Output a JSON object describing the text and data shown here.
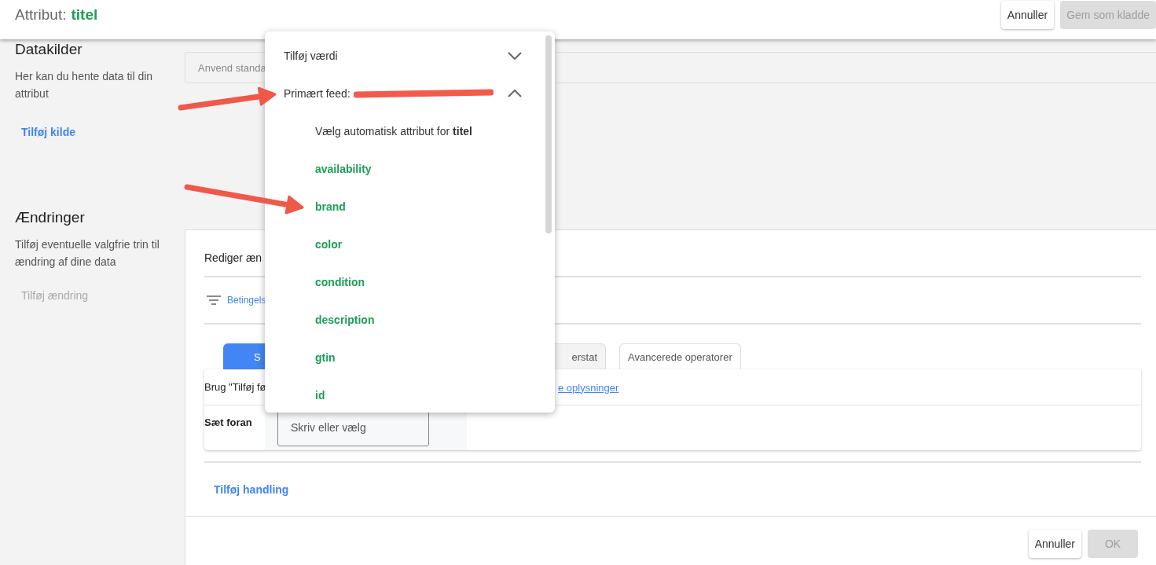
{
  "header": {
    "title_label": "Attribut:",
    "title_value": "titel",
    "buttons": [
      {
        "label": "Annuller",
        "disabled": false
      },
      {
        "label": "Gem som kladde",
        "disabled": true
      }
    ]
  },
  "data_sources": {
    "heading": "Datakilder",
    "description": "Her kan du hente data til din attribut",
    "add_link": "Tilføj kilde",
    "source_field": {
      "placeholder": "Anvend standa"
    }
  },
  "changes": {
    "heading": "Ændringer",
    "description": "Tilføj eventuelle valgfrie trin til ændring af dine data",
    "add_link": {
      "label": "Tilføj ændring",
      "disabled": true
    }
  },
  "editor": {
    "title": "Rediger æn",
    "condition_link": "Betingels",
    "tabs": [
      {
        "label": "S",
        "selected": true
      },
      {
        "label": "erstat",
        "selected": false
      },
      {
        "label": "Avancerede operatorer",
        "selected": false
      }
    ],
    "info_text": "Brug \"Tilføj fø",
    "info_link": "e oplysninger",
    "prefix_label": "Sæt foran",
    "prefix_field": {
      "placeholder": "Skriv eller vælg"
    },
    "add_action": "Tilføj handling",
    "buttons": [
      {
        "label": "Annuller",
        "disabled": false
      },
      {
        "label": "OK",
        "disabled": true
      }
    ]
  },
  "dropdown": {
    "sections": [
      {
        "label": "Tilføj værdi",
        "expanded": false,
        "redacted": false
      },
      {
        "label": "Primært feed:",
        "expanded": true,
        "redacted": true,
        "items": [
          {
            "kind": "option",
            "text": "Vælg automatisk attribut for **titel**"
          },
          {
            "kind": "attribute",
            "text": "**availability**"
          },
          {
            "kind": "attribute",
            "text": "**brand**"
          },
          {
            "kind": "attribute",
            "text": "**color**"
          },
          {
            "kind": "attribute",
            "text": "**condition**"
          },
          {
            "kind": "attribute",
            "text": "**description**"
          },
          {
            "kind": "attribute",
            "text": "**gtin**"
          },
          {
            "kind": "attribute",
            "text": "**id**"
          }
        ]
      }
    ]
  }
}
